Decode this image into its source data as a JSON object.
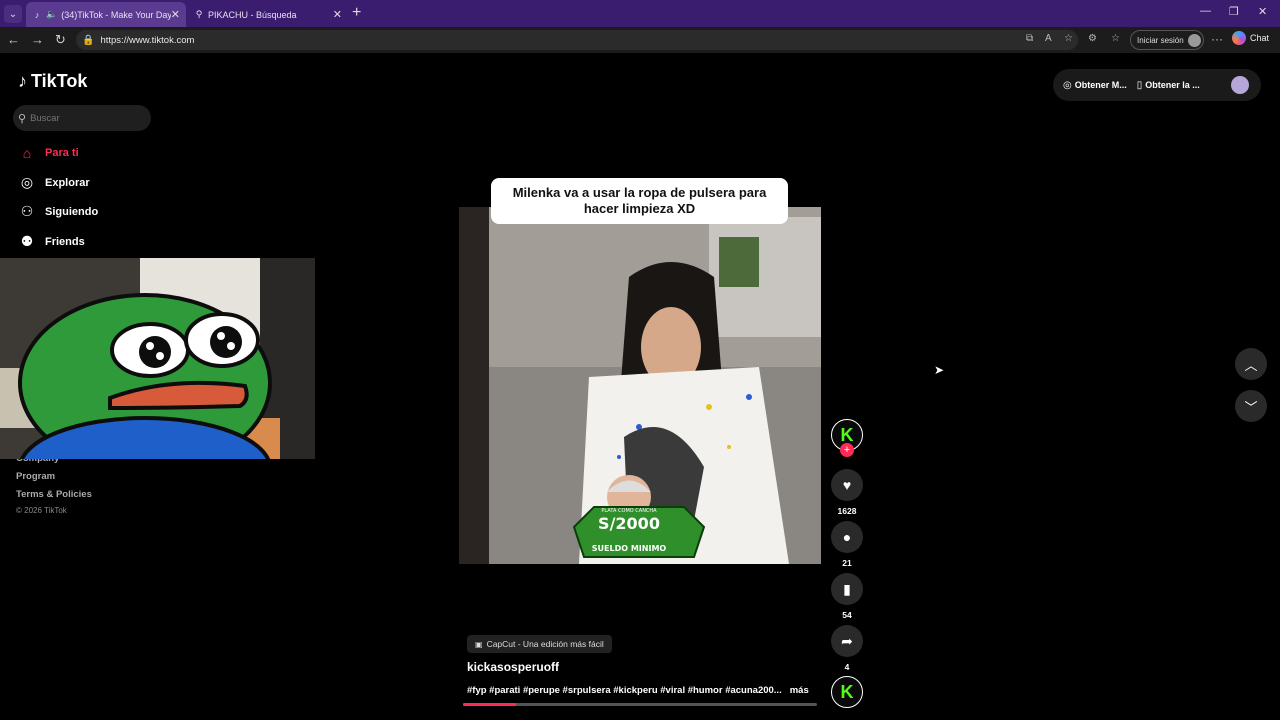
{
  "browser": {
    "tabs": [
      {
        "title": "(34)TikTok - Make Your Day",
        "favicon": "tiktok-icon",
        "audio": true,
        "active": true
      },
      {
        "title": "PIKACHU - Búsqueda",
        "favicon": "search-icon",
        "active": false
      }
    ],
    "url": "https://www.tiktok.com",
    "signin_label": "Iniciar sesión",
    "chat_label": "Chat"
  },
  "sidebar": {
    "logo_text": "TikTok",
    "search_placeholder": "Buscar",
    "nav": [
      {
        "label": "Para ti",
        "icon": "home-icon",
        "active": true
      },
      {
        "label": "Explorar",
        "icon": "compass-icon"
      },
      {
        "label": "Siguiendo",
        "icon": "following-icon"
      },
      {
        "label": "Friends",
        "icon": "friends-icon"
      }
    ],
    "footer": [
      "Company",
      "Program",
      "Terms & Policies"
    ],
    "copyright": "© 2026 TikTok"
  },
  "topbar": {
    "coins_label": "Obtener M...",
    "app_label": "Obtener la ..."
  },
  "video": {
    "caption": "Milenka va a usar la ropa de pulsera para hacer limpieza XD",
    "sticker_top": "PLATA COMO CANCHA",
    "sticker_amount": "S/2000",
    "sticker_bottom": "SUELDO MINIMO",
    "capcut_label": "CapCut - Una edición más fácil",
    "username": "kickasosperuoff",
    "hashtags": "#fyp #parati #perupe #srpulsera #kickperu #viral #humor #acuna200...",
    "more_label": "más",
    "progress": 0.15,
    "likes": "1628",
    "comments": "21",
    "saves": "54",
    "shares": "4"
  },
  "colors": {
    "accent": "#fe2c55",
    "kick_green": "#53fc18",
    "tab_bar": "#3a1d6e"
  }
}
